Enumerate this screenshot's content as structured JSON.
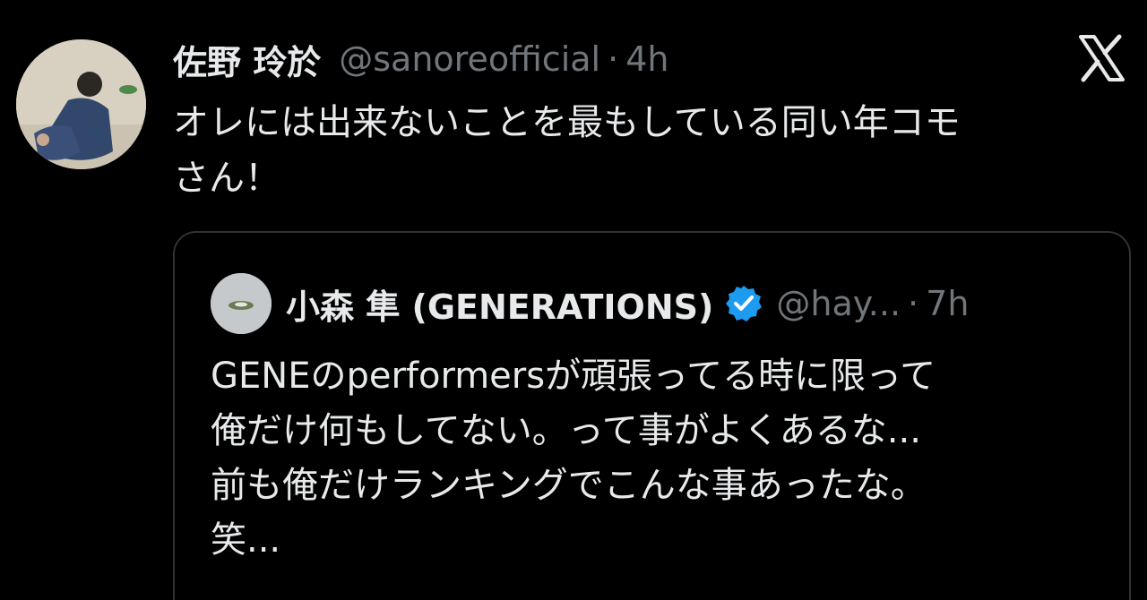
{
  "post": {
    "display_name": "佐野 玲於",
    "handle": "@sanoreofficial",
    "separator": "·",
    "time": "4h",
    "text_lines": [
      "オレには出来ないことを最もしている同い年コモ",
      "さん！"
    ]
  },
  "quote": {
    "display_name": "小森 隼 (GENERATIONS)",
    "handle": "@hay...",
    "separator": "·",
    "time": "7h",
    "text_lines": [
      "GENEのperformersが頑張ってる時に限って",
      "俺だけ何もしてない。って事がよくあるな...",
      "前も俺だけランキングでこんな事あったな。",
      "笑..."
    ]
  },
  "icons": {
    "logo": "x-logo-icon",
    "verified": "verified-badge-icon",
    "avatar": "avatar",
    "quote_avatar": "quote-avatar"
  },
  "colors": {
    "background": "#000000",
    "primary_text": "#e7e9ea",
    "secondary_text": "#71767b",
    "border": "#2f3336",
    "verified_blue": "#1d9bf0"
  }
}
